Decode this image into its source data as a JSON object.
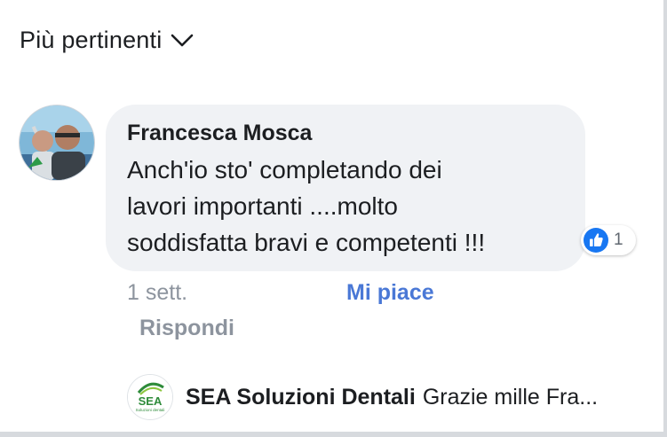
{
  "sort": {
    "label": "Più pertinenti"
  },
  "comment": {
    "author": "Francesca Mosca",
    "text_lines": [
      "Anch'io sto' completando dei",
      "lavori importanti ....molto",
      "soddisfatta bravi e competenti  !!!"
    ],
    "reaction_count": "1",
    "time": "1 sett.",
    "like_label": "Mi piace",
    "reply_label": "Rispondi"
  },
  "reply": {
    "author": "SEA Soluzioni Dentali",
    "text": "Grazie mille Fra...",
    "logo_text": "SEA",
    "logo_subtext": "Soluzioni dentali"
  },
  "colors": {
    "like_blue": "#1877f2",
    "link_blue": "#4a78d6",
    "bubble_bg": "#f0f2f5",
    "sea_green": "#2e8b3a"
  },
  "icons": {
    "sort_chevron": "chevron-down-icon",
    "reaction": "like-thumb-icon"
  }
}
